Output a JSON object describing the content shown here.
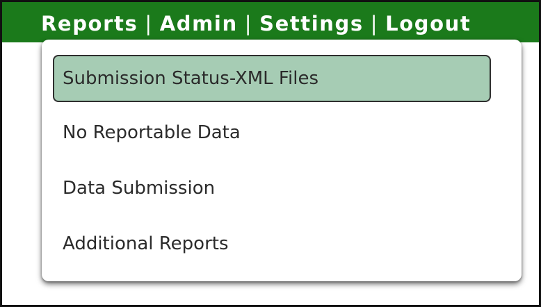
{
  "nav": {
    "links": [
      "Reports",
      "Admin",
      "Settings",
      "Logout"
    ],
    "separator": "|"
  },
  "reports_menu": {
    "items": [
      {
        "label": "Submission Status-XML Files",
        "highlighted": true
      },
      {
        "label": "No Reportable Data",
        "highlighted": false
      },
      {
        "label": "Data Submission",
        "highlighted": false
      },
      {
        "label": "Additional Reports",
        "highlighted": false
      }
    ]
  },
  "colors": {
    "navbar": "#1b7a1b",
    "highlight": "#a6ccb4",
    "text": "#2b2b2b"
  }
}
